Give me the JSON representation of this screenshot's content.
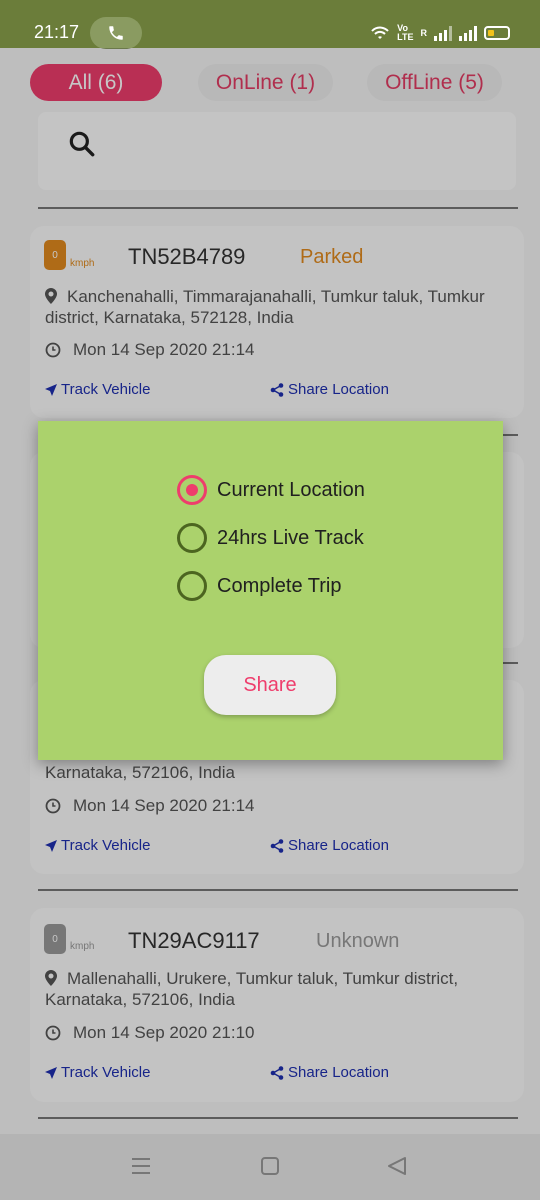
{
  "status_bar": {
    "time": "21:17",
    "volte": "Vo\nLTE",
    "carrier_letter": "R"
  },
  "tabs": [
    {
      "label": "All (6)",
      "active": true
    },
    {
      "label": "OnLine (1)",
      "active": false
    },
    {
      "label": "OffLine (5)",
      "active": false
    }
  ],
  "vehicles": [
    {
      "speed": "0",
      "unit": "kmph",
      "registration": "TN52B4789",
      "status": "Parked",
      "status_color": "#e08a1e",
      "badge_color": "#e08a1e",
      "address": "Kanchenahalli, Timmarajanahalli, Tumkur taluk, Tumkur district, Karnataka, 572128, India",
      "timestamp": "Mon 14 Sep 2020 21:14",
      "track_label": "Track Vehicle",
      "share_label": "Share Location"
    },
    {
      "address": "Karnataka, 572106, India",
      "timestamp": "Mon 14 Sep 2020 21:14",
      "track_label": "Track Vehicle",
      "share_label": "Share Location"
    },
    {
      "speed": "0",
      "unit": "kmph",
      "registration": "TN29AC9117",
      "status": "Unknown",
      "status_color": "#999999",
      "badge_color": "#999999",
      "address": "Mallenahalli, Urukere, Tumkur taluk, Tumkur district, Karnataka, 572106, India",
      "timestamp": "Mon 14 Sep 2020 21:10",
      "track_label": "Track Vehicle",
      "share_label": "Share Location"
    }
  ],
  "dialog": {
    "options": [
      {
        "label": "Current Location",
        "selected": true
      },
      {
        "label": "24hrs Live Track",
        "selected": false
      },
      {
        "label": "Complete Trip",
        "selected": false
      }
    ],
    "share_button": "Share"
  },
  "colors": {
    "accent": "#ee3d6c",
    "dialog_bg": "#abd26c",
    "link": "#1e2fb0"
  },
  "icons": {
    "search": "search-icon",
    "pin": "location-pin-icon",
    "clock": "clock-icon",
    "track": "navigation-arrow-icon",
    "share": "share-icon"
  }
}
